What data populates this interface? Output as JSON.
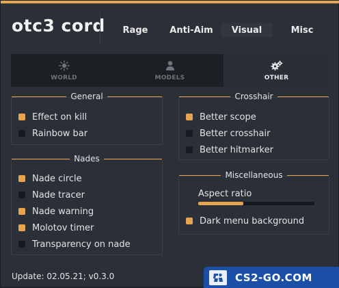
{
  "app": {
    "title": "otc3 cord"
  },
  "tabs": [
    {
      "label": "Rage"
    },
    {
      "label": "Anti-Aim"
    },
    {
      "label": "Visual",
      "active": true
    },
    {
      "label": "Misc"
    }
  ],
  "subtabs": [
    {
      "label": "WORLD",
      "icon": "sun-icon"
    },
    {
      "label": "MODELS",
      "icon": "person-icon"
    },
    {
      "label": "OTHER",
      "icon": "gears-icon",
      "active": true
    }
  ],
  "groups": {
    "general": {
      "title": "General",
      "items": [
        {
          "label": "Effect on kill",
          "checked": true
        },
        {
          "label": "Rainbow bar",
          "checked": false
        }
      ]
    },
    "nades": {
      "title": "Nades",
      "items": [
        {
          "label": "Nade circle",
          "checked": true
        },
        {
          "label": "Nade tracer",
          "checked": false
        },
        {
          "label": "Nade warning",
          "checked": true
        },
        {
          "label": "Molotov timer",
          "checked": true
        },
        {
          "label": "Transparency on nade",
          "checked": false
        }
      ]
    },
    "crosshair": {
      "title": "Crosshair",
      "items": [
        {
          "label": "Better scope",
          "checked": true
        },
        {
          "label": "Better crosshair",
          "checked": false
        },
        {
          "label": "Better hitmarker",
          "checked": false
        }
      ]
    },
    "misc": {
      "title": "Miscellaneous",
      "slider": {
        "label": "Aspect ratio",
        "fraction": 0.39
      },
      "items": [
        {
          "label": "Dark menu background",
          "checked": true
        }
      ]
    }
  },
  "footer": {
    "text": "Update: 02.05.21; v0.3.0"
  },
  "watermark": {
    "text": "CS2-GO.COM"
  },
  "colors": {
    "accent": "#e8a550",
    "panel": "#2b2f37",
    "subbar": "#1c1f24",
    "watermark": "#1c4fa6"
  }
}
